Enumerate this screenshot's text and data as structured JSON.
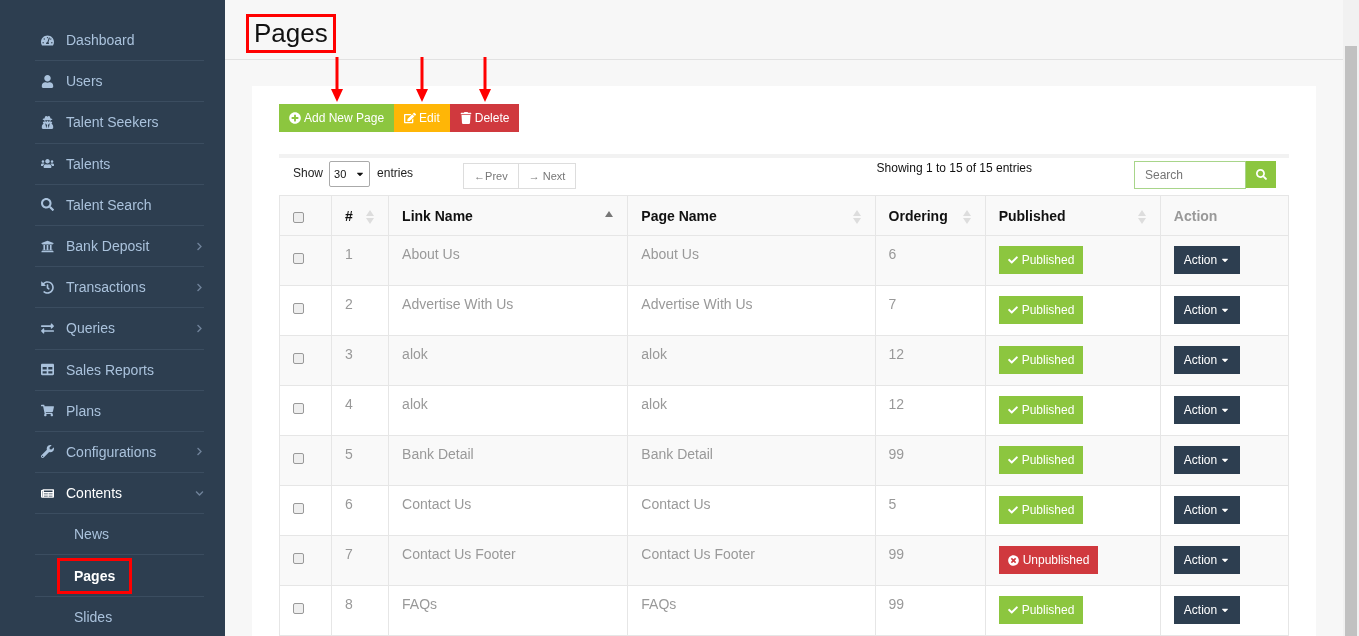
{
  "sidebar": {
    "items": [
      {
        "label": "Dashboard",
        "selected": false
      },
      {
        "label": "Users",
        "selected": false
      },
      {
        "label": "Talent Seekers",
        "selected": false
      },
      {
        "label": "Talents",
        "selected": false
      },
      {
        "label": "Talent Search",
        "selected": false
      },
      {
        "label": "Bank Deposit",
        "selected": false,
        "expanded": false
      },
      {
        "label": "Transactions",
        "selected": false,
        "expanded": false
      },
      {
        "label": "Queries",
        "selected": false,
        "expanded": false
      },
      {
        "label": "Sales Reports",
        "selected": false
      },
      {
        "label": "Plans",
        "selected": false
      },
      {
        "label": "Configurations",
        "selected": false,
        "expanded": false
      },
      {
        "label": "Contents",
        "selected": true,
        "expanded": true,
        "children": [
          {
            "label": "News",
            "selected": false,
            "highlighted": false
          },
          {
            "label": "Pages",
            "selected": true,
            "highlighted": true
          },
          {
            "label": "Slides",
            "selected": false,
            "highlighted": false
          }
        ]
      }
    ]
  },
  "page": {
    "title": "Pages",
    "title_highlighted": true
  },
  "toolbar": [
    {
      "label": "Add New Page",
      "kind": "add",
      "annotated": true
    },
    {
      "label": "Edit",
      "kind": "edit",
      "annotated": true
    },
    {
      "label": "Delete",
      "kind": "delete",
      "annotated": true
    }
  ],
  "table_controls": {
    "show_label": "Show",
    "page_size": "30",
    "entries_label": "entries",
    "prev": "←Prev",
    "next": "→ Next",
    "info": "Showing 1 to 15 of 15 entries",
    "search": {
      "placeholder": "Search"
    }
  },
  "table": {
    "select_all": {
      "checked": false
    },
    "columns": [
      {
        "label": "#",
        "sortable": true,
        "sorted": false
      },
      {
        "label": "Link Name",
        "sortable": true,
        "sorted": true
      },
      {
        "label": "Page Name",
        "sortable": true,
        "sorted": false
      },
      {
        "label": "Ordering",
        "sortable": true,
        "sorted": false
      },
      {
        "label": "Published",
        "sortable": true,
        "sorted": false
      },
      {
        "label": "Action",
        "sortable": false,
        "sorted": false
      }
    ],
    "rows": [
      {
        "checked": false,
        "number": "1",
        "link_name": "About Us",
        "page_name": "About Us",
        "ordering": "6",
        "published": true,
        "status": "Published",
        "action": "Action"
      },
      {
        "checked": false,
        "number": "2",
        "link_name": "Advertise With Us",
        "page_name": "Advertise With Us",
        "ordering": "7",
        "published": true,
        "status": "Published",
        "action": "Action"
      },
      {
        "checked": false,
        "number": "3",
        "link_name": "alok",
        "page_name": "alok",
        "ordering": "12",
        "published": true,
        "status": "Published",
        "action": "Action"
      },
      {
        "checked": false,
        "number": "4",
        "link_name": "alok",
        "page_name": "alok",
        "ordering": "12",
        "published": true,
        "status": "Published",
        "action": "Action"
      },
      {
        "checked": false,
        "number": "5",
        "link_name": "Bank Detail",
        "page_name": "Bank Detail",
        "ordering": "99",
        "published": true,
        "status": "Published",
        "action": "Action"
      },
      {
        "checked": false,
        "number": "6",
        "link_name": "Contact Us",
        "page_name": "Contact Us",
        "ordering": "5",
        "published": true,
        "status": "Published",
        "action": "Action"
      },
      {
        "checked": false,
        "number": "7",
        "link_name": "Contact Us Footer",
        "page_name": "Contact Us Footer",
        "ordering": "99",
        "published": false,
        "status": "Unpublished",
        "action": "Action"
      },
      {
        "checked": false,
        "number": "8",
        "link_name": "FAQs",
        "page_name": "FAQs",
        "ordering": "99",
        "published": true,
        "status": "Published",
        "action": "Action"
      }
    ]
  }
}
